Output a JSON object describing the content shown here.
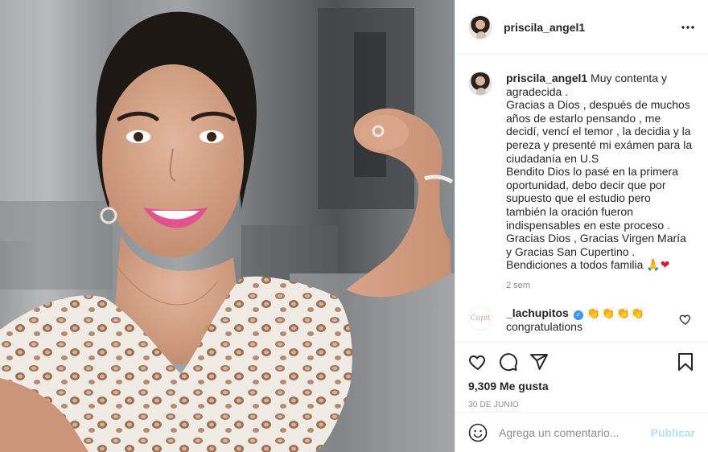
{
  "post": {
    "image_alt": "Mujer sonriente mostrando su bíceps"
  },
  "header": {
    "username": "priscila_angel1",
    "more_icon": "more-horizontal-icon"
  },
  "caption": {
    "username": "priscila_angel1",
    "text": " Muy contenta y agradecida .\nGracias a Dios , después de muchos años de estarlo pensando , me decidí, vencí el temor , la decidia y la pereza y presenté mi exámen para la ciudadanía en U.S\nBendito Dios lo pasé en la primera oportunidad, debo decir que por supuesto que el estudio pero también la oración fueron indispensables en este proceso .\nGracias Dios , Gracias Virgen María y Gracias San Cupertino .\nBendiciones a todos familia ",
    "emoji_pray": "🙏",
    "emoji_heart": "❤",
    "time": "2 sem"
  },
  "comment": {
    "avatar_text": "Cupit",
    "username": "_lachupitos",
    "verified": "✓",
    "emojis": "👏👏👏👏",
    "text": "congratulations"
  },
  "actions": {
    "likes": "9,309 Me gusta",
    "date": "30 DE JUNIO",
    "icons": [
      "heart-icon",
      "comment-icon",
      "share-icon",
      "bookmark-icon"
    ]
  },
  "add_comment": {
    "placeholder": "Agrega un comentario...",
    "publish_label": "Publicar"
  },
  "colors": {
    "accent": "#3897f0",
    "publish_disabled": "#b2dffc",
    "secondary_text": "#8e8e8e"
  }
}
